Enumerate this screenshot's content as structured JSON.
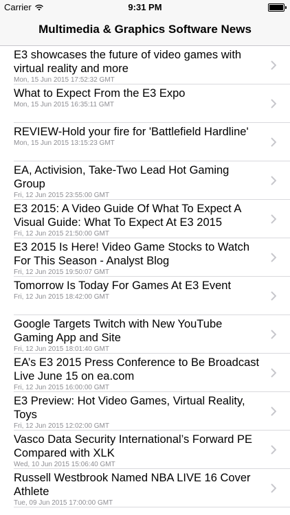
{
  "status": {
    "carrier": "Carrier",
    "time": "9:31 PM"
  },
  "nav": {
    "title": "Multimedia & Graphics Software News"
  },
  "articles": [
    {
      "title": "E3 showcases the future of video games with virtual reality and more",
      "date": "Mon, 15 Jun 2015 17:52:32 GMT"
    },
    {
      "title": "What to Expect From the E3 Expo",
      "date": "Mon, 15 Jun 2015 16:35:11 GMT"
    },
    {
      "title": "REVIEW-Hold your fire for 'Battlefield Hardline'",
      "date": "Mon, 15 Jun 2015 13:15:23 GMT"
    },
    {
      "title": "EA, Activision, Take-Two Lead Hot Gaming Group",
      "date": "Fri, 12 Jun 2015 23:55:00 GMT"
    },
    {
      "title": "E3 2015: A Video Guide Of What To Expect A Visual Guide: What To Expect At E3 2015",
      "date": "Fri, 12 Jun 2015 21:50:00 GMT"
    },
    {
      "title": "E3 2015 Is Here! Video Game Stocks to Watch For This Season - Analyst Blog",
      "date": "Fri, 12 Jun 2015 19:50:07 GMT"
    },
    {
      "title": "Tomorrow Is Today For Games At E3 Event",
      "date": "Fri, 12 Jun 2015 18:42:00 GMT"
    },
    {
      "title": "Google Targets Twitch with New YouTube Gaming App and Site",
      "date": "Fri, 12 Jun 2015 18:01:40 GMT"
    },
    {
      "title": "EA’s E3 2015 Press Conference to Be Broadcast Live June 15 on ea.com",
      "date": "Fri, 12 Jun 2015 16:00:00 GMT"
    },
    {
      "title": "E3 Preview: Hot Video Games, Virtual Reality, Toys",
      "date": "Fri, 12 Jun 2015 12:02:00 GMT"
    },
    {
      "title": "Vasco Data Security International’s Forward PE Compared with XLK",
      "date": "Wed, 10 Jun 2015 15:06:40 GMT"
    },
    {
      "title": "Russell Westbrook Named NBA LIVE 16 Cover Athlete",
      "date": "Tue, 09 Jun 2015 17:00:00 GMT"
    }
  ],
  "icons": {
    "wifi": "wifi-icon",
    "battery": "battery-icon",
    "chevron": "chevron-right-icon"
  }
}
